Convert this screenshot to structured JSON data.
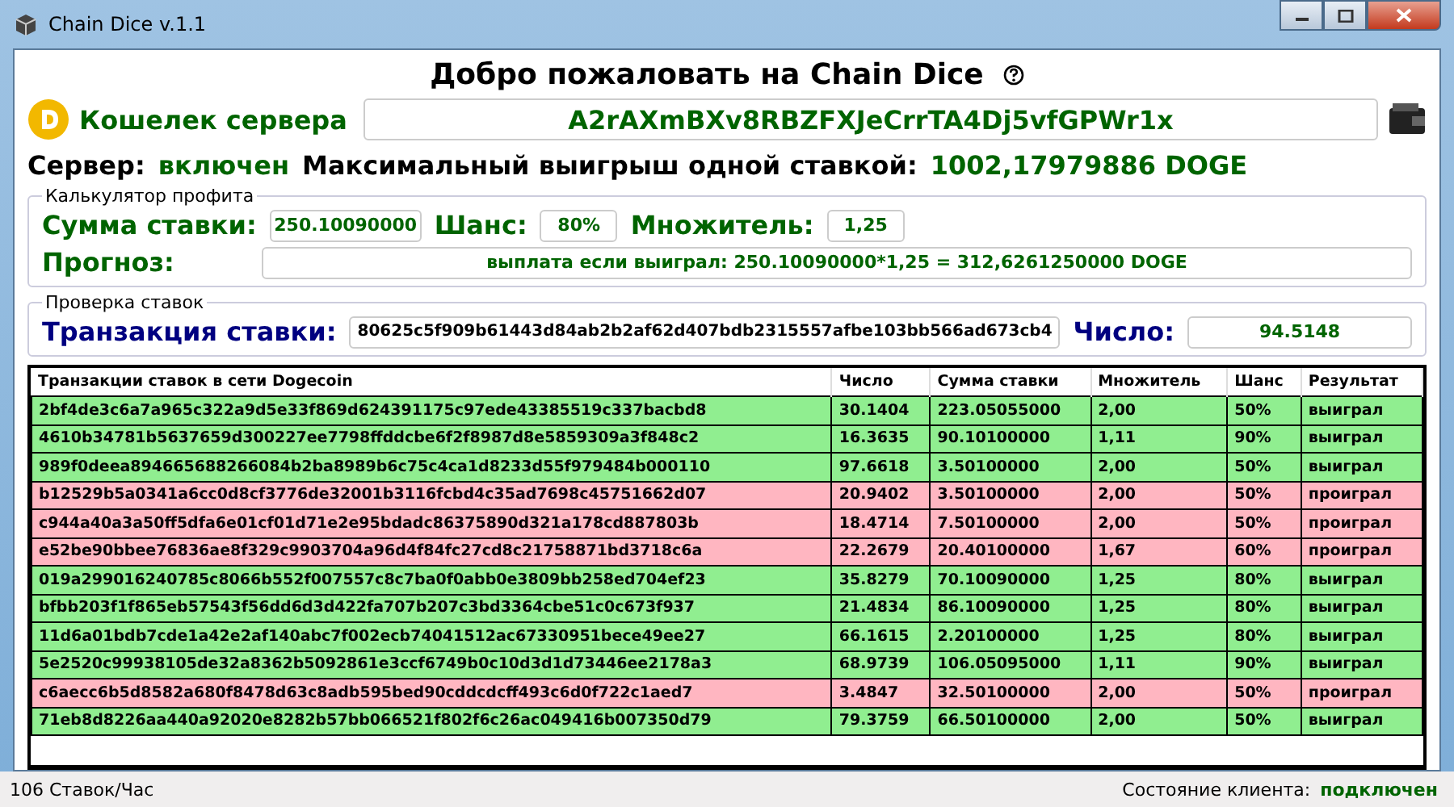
{
  "window": {
    "title": "Chain Dice v.1.1"
  },
  "welcome": "Добро пожаловать на Chain Dice",
  "wallet": {
    "label": "Кошелек сервера",
    "address": "A2rAXmBXv8RBZFXJeCrrTA4Dj5vfGPWr1x"
  },
  "server": {
    "label": "Сервер:",
    "status": "включен",
    "on": true,
    "max_label": "Максимальный выигрыш одной ставкой:",
    "max_value": "1002,17979886 DOGE"
  },
  "calculator": {
    "title": "Калькулятор профита",
    "amount_label": "Сумма ставки:",
    "amount": "250.10090000",
    "chance_label": "Шанс:",
    "chance": "80%",
    "multiplier_label": "Множитель:",
    "multiplier": "1,25",
    "forecast_label": "Прогноз:",
    "forecast": "выплата если выиграл: 250.10090000*1,25 = 312,6261250000 DOGE"
  },
  "check": {
    "title": "Проверка ставок",
    "tx_label": "Транзакция ставки:",
    "tx": "80625c5f909b61443d84ab2b2af62d407bdb2315557afbe103bb566ad673cb4",
    "number_label": "Число:",
    "number": "94.5148"
  },
  "table": {
    "columns": [
      "Транзакции ставок в сети Dogecoin",
      "Число",
      "Сумма ставки",
      "Множитель",
      "Шанс",
      "Результат"
    ],
    "rows": [
      {
        "won": true,
        "cells": [
          "2bf4de3c6a7a965c322a9d5e33f869d624391175c97ede43385519c337bacbd8",
          "30.1404",
          "223.05055000",
          "2,00",
          "50%",
          "выиграл"
        ]
      },
      {
        "won": true,
        "cells": [
          "4610b34781b5637659d300227ee7798ffddcbe6f2f8987d8e5859309a3f848c2",
          "16.3635",
          "90.10100000",
          "1,11",
          "90%",
          "выиграл"
        ]
      },
      {
        "won": true,
        "cells": [
          "989f0deea894665688266084b2ba8989b6c75c4ca1d8233d55f979484b000110",
          "97.6618",
          "3.50100000",
          "2,00",
          "50%",
          "выиграл"
        ]
      },
      {
        "won": false,
        "cells": [
          "b12529b5a0341a6cc0d8cf3776de32001b3116fcbd4c35ad7698c45751662d07",
          "20.9402",
          "3.50100000",
          "2,00",
          "50%",
          "проиграл"
        ]
      },
      {
        "won": false,
        "cells": [
          "c944a40a3a50ff5dfa6e01cf01d71e2e95bdadc86375890d321a178cd887803b",
          "18.4714",
          "7.50100000",
          "2,00",
          "50%",
          "проиграл"
        ]
      },
      {
        "won": false,
        "cells": [
          "e52be90bbee76836ae8f329c9903704a96d4f84fc27cd8c21758871bd3718c6a",
          "22.2679",
          "20.40100000",
          "1,67",
          "60%",
          "проиграл"
        ]
      },
      {
        "won": true,
        "cells": [
          "019a299016240785c8066b552f007557c8c7ba0f0abb0e3809bb258ed704ef23",
          "35.8279",
          "70.10090000",
          "1,25",
          "80%",
          "выиграл"
        ]
      },
      {
        "won": true,
        "cells": [
          "bfbb203f1f865eb57543f56dd6d3d422fa707b207c3bd3364cbe51c0c673f937",
          "21.4834",
          "86.10090000",
          "1,25",
          "80%",
          "выиграл"
        ]
      },
      {
        "won": true,
        "cells": [
          "11d6a01bdb7cde1a42e2af140abc7f002ecb74041512ac67330951bece49ee27",
          "66.1615",
          "2.20100000",
          "1,25",
          "80%",
          "выиграл"
        ]
      },
      {
        "won": true,
        "cells": [
          "5e2520c99938105de32a8362b5092861e3ccf6749b0c10d3d1d73446ee2178a3",
          "68.9739",
          "106.05095000",
          "1,11",
          "90%",
          "выиграл"
        ]
      },
      {
        "won": false,
        "cells": [
          "c6aecc6b5d8582a680f8478d63c8adb595bed90cddcdcff493c6d0f722c1aed7",
          "3.4847",
          "32.50100000",
          "2,00",
          "50%",
          "проиграл"
        ]
      },
      {
        "won": true,
        "cells": [
          "71eb8d8226aa440a92020e8282b57bb066521f802f6c26ac049416b007350d79",
          "79.3759",
          "66.50100000",
          "2,00",
          "50%",
          "выиграл"
        ]
      }
    ]
  },
  "status_bar": {
    "rate": "106 Ставок/Час",
    "client_label": "Состояние клиента:",
    "client_status": "подключен",
    "connected": true
  }
}
